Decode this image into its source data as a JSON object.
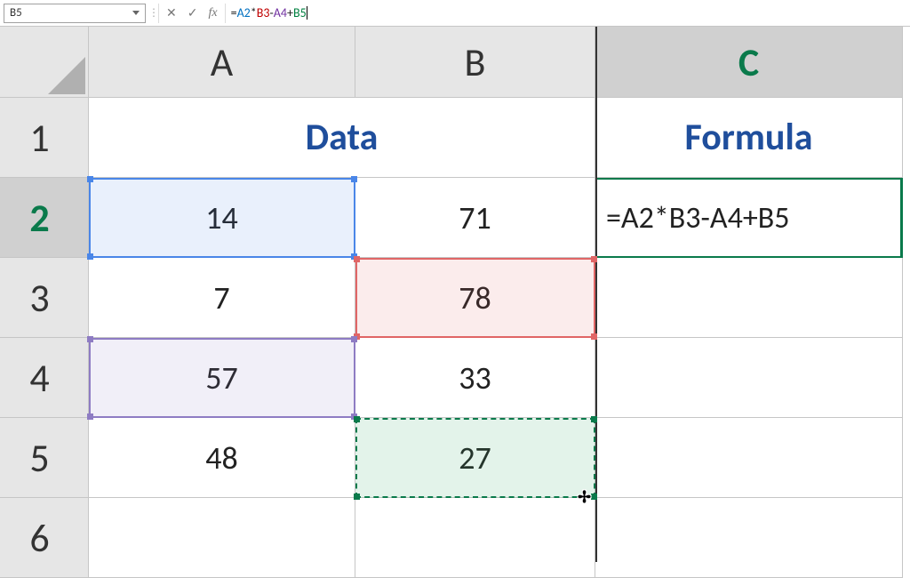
{
  "formulaBar": {
    "nameBox": "B5",
    "cancelLabel": "✕",
    "acceptLabel": "✓",
    "fxLabel": "fx",
    "tokens": {
      "eq": "=",
      "a2": "A2",
      "star": "*",
      "b3": "B3",
      "minus": "-",
      "a4": "A4",
      "plus": "+",
      "b5": "B5"
    }
  },
  "columns": {
    "labels": [
      "A",
      "B",
      "C"
    ],
    "activeIndex": 2
  },
  "rows": {
    "labels": [
      "1",
      "2",
      "3",
      "4",
      "5",
      "6"
    ],
    "activeIndex": 1
  },
  "headers": {
    "data": "Data",
    "formula": "Formula"
  },
  "cells": {
    "A2": "14",
    "B2": "71",
    "C2": "=A2*B3-A4+B5",
    "A3": "7",
    "B3": "78",
    "A4": "57",
    "B4": "33",
    "A5": "48",
    "B5": "27"
  },
  "references": [
    {
      "cell": "A2",
      "color": "blue"
    },
    {
      "cell": "B3",
      "color": "red"
    },
    {
      "cell": "A4",
      "color": "purple"
    },
    {
      "cell": "B5",
      "color": "green",
      "style": "dashed"
    }
  ],
  "cursor": {
    "glyph": "✢"
  }
}
